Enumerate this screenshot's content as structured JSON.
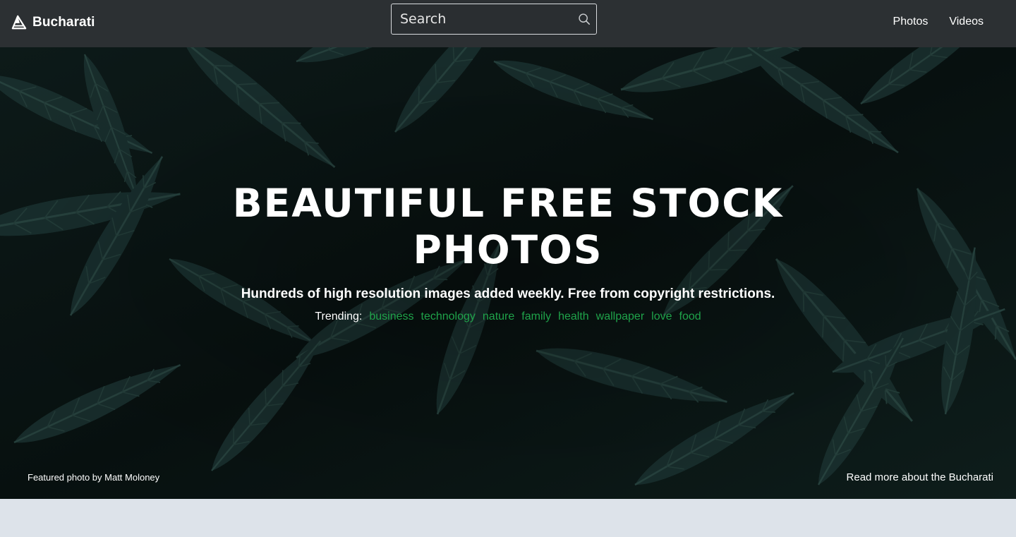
{
  "nav": {
    "brand": "Bucharati",
    "search_placeholder": "Search",
    "links": [
      "Photos",
      "Videos"
    ]
  },
  "hero": {
    "title": "BEAUTIFUL FREE STOCK PHOTOS",
    "subtitle": "Hundreds of high resolution images added weekly. Free from copyright restrictions.",
    "trending_label": "Trending:",
    "trending_tags": [
      "business",
      "technology",
      "nature",
      "family",
      "health",
      "wallpaper",
      "love",
      "food"
    ],
    "photo_credit": "Featured photo by Matt Moloney",
    "read_more": "Read more about the Bucharati"
  },
  "colors": {
    "navbar_bg": "#2c3033",
    "tag_green": "#1fa34a",
    "below_hero_bg": "#dde3ea"
  },
  "icons": {
    "brand": "sail-logo-icon",
    "search": "search-icon"
  }
}
